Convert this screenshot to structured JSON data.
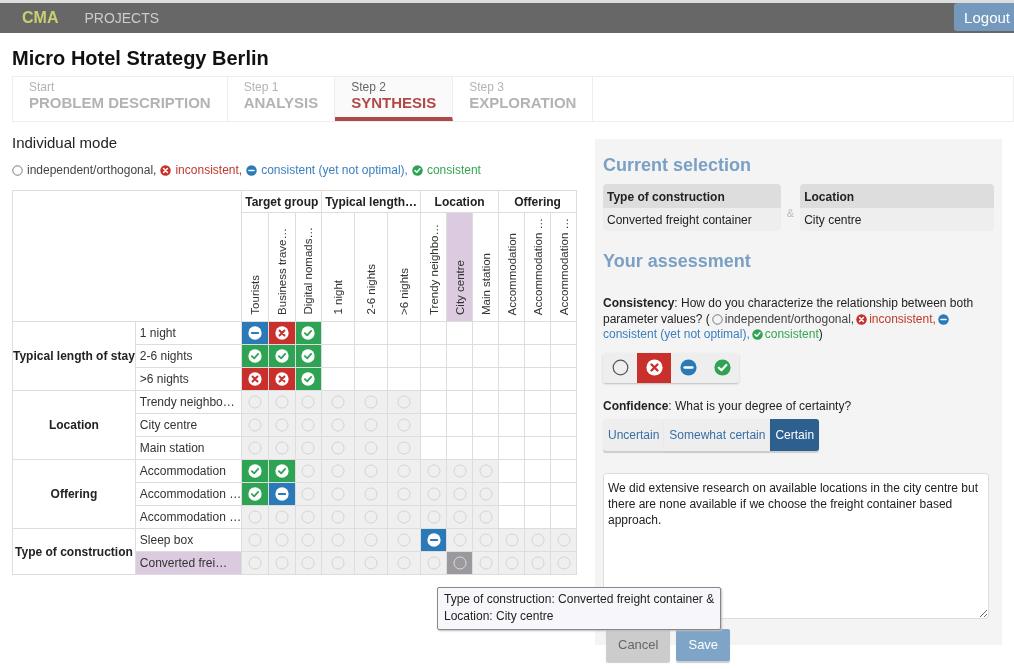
{
  "navbar": {
    "brand": "CMA",
    "menu_item": "PROJECTS",
    "logout": "Logout"
  },
  "project_title": "Micro Hotel Strategy Berlin",
  "steps": [
    {
      "label": "Start",
      "title": "PROBLEM DESCRIPTION",
      "selected": false
    },
    {
      "label": "Step 1",
      "title": "ANALYSIS",
      "selected": false
    },
    {
      "label": "Step 2",
      "title": "SYNTHESIS",
      "selected": true
    },
    {
      "label": "Step 3",
      "title": "EXPLORATION",
      "selected": false
    }
  ],
  "mode": "Individual mode",
  "legend": [
    {
      "kind": "independent",
      "label": "independent/orthogonal,"
    },
    {
      "kind": "inconsistent",
      "label": "inconsistent,"
    },
    {
      "kind": "partial",
      "label": "consistent (yet not optimal),"
    },
    {
      "kind": "consistent",
      "label": "consistent"
    }
  ],
  "matrix": {
    "column_groups": [
      {
        "label": "Target group",
        "columns": [
          {
            "label": "Tourists",
            "highlighted": false
          },
          {
            "label": "Business trave…",
            "highlighted": false
          },
          {
            "label": "Digital nomads…",
            "highlighted": false
          }
        ]
      },
      {
        "label": "Typical length…",
        "columns": [
          {
            "label": "1 night",
            "highlighted": false
          },
          {
            "label": "2-6 nights",
            "highlighted": false
          },
          {
            "label": ">6 nights",
            "highlighted": false
          }
        ]
      },
      {
        "label": "Location",
        "columns": [
          {
            "label": "Trendy neighbo…",
            "highlighted": false
          },
          {
            "label": "City centre",
            "highlighted": true
          },
          {
            "label": "Main station",
            "highlighted": false
          }
        ]
      },
      {
        "label": "Offering",
        "columns": [
          {
            "label": "Accommodation",
            "highlighted": false
          },
          {
            "label": "Accommodation …",
            "highlighted": false
          },
          {
            "label": "Accommodation …",
            "highlighted": false
          }
        ]
      }
    ],
    "row_groups": [
      {
        "label": "Typical length of stay",
        "rows": [
          {
            "label": "1 night",
            "highlighted": false,
            "cells": [
              {
                "kind": "partial",
                "selected": false
              },
              {
                "kind": "inconsistent",
                "selected": false
              },
              {
                "kind": "consistent",
                "selected": false
              },
              {
                "kind": "none",
                "selected": false
              },
              {
                "kind": "none",
                "selected": false
              },
              {
                "kind": "none",
                "selected": false
              },
              {
                "kind": "none",
                "selected": false
              },
              {
                "kind": "none",
                "selected": false
              },
              {
                "kind": "none",
                "selected": false
              },
              {
                "kind": "none",
                "selected": false
              },
              {
                "kind": "none",
                "selected": false
              },
              {
                "kind": "none",
                "selected": false
              }
            ]
          },
          {
            "label": "2-6 nights",
            "highlighted": false,
            "cells": [
              {
                "kind": "consistent",
                "selected": false
              },
              {
                "kind": "consistent",
                "selected": false
              },
              {
                "kind": "consistent",
                "selected": false
              },
              {
                "kind": "none",
                "selected": false
              },
              {
                "kind": "none",
                "selected": false
              },
              {
                "kind": "none",
                "selected": false
              },
              {
                "kind": "none",
                "selected": false
              },
              {
                "kind": "none",
                "selected": false
              },
              {
                "kind": "none",
                "selected": false
              },
              {
                "kind": "none",
                "selected": false
              },
              {
                "kind": "none",
                "selected": false
              },
              {
                "kind": "none",
                "selected": false
              }
            ]
          },
          {
            "label": ">6 nights",
            "highlighted": false,
            "cells": [
              {
                "kind": "inconsistent",
                "selected": false
              },
              {
                "kind": "inconsistent",
                "selected": false
              },
              {
                "kind": "consistent",
                "selected": false
              },
              {
                "kind": "none",
                "selected": false
              },
              {
                "kind": "none",
                "selected": false
              },
              {
                "kind": "none",
                "selected": false
              },
              {
                "kind": "none",
                "selected": false
              },
              {
                "kind": "none",
                "selected": false
              },
              {
                "kind": "none",
                "selected": false
              },
              {
                "kind": "none",
                "selected": false
              },
              {
                "kind": "none",
                "selected": false
              },
              {
                "kind": "none",
                "selected": false
              }
            ]
          }
        ]
      },
      {
        "label": "Location",
        "rows": [
          {
            "label": "Trendy neighbo…",
            "highlighted": false,
            "cells": [
              {
                "kind": "independent",
                "selected": false
              },
              {
                "kind": "independent",
                "selected": false
              },
              {
                "kind": "independent",
                "selected": false
              },
              {
                "kind": "independent",
                "selected": false
              },
              {
                "kind": "independent",
                "selected": false
              },
              {
                "kind": "independent",
                "selected": false
              },
              {
                "kind": "none",
                "selected": false
              },
              {
                "kind": "none",
                "selected": false
              },
              {
                "kind": "none",
                "selected": false
              },
              {
                "kind": "none",
                "selected": false
              },
              {
                "kind": "none",
                "selected": false
              },
              {
                "kind": "none",
                "selected": false
              }
            ]
          },
          {
            "label": "City centre",
            "highlighted": false,
            "cells": [
              {
                "kind": "independent",
                "selected": false
              },
              {
                "kind": "independent",
                "selected": false
              },
              {
                "kind": "independent",
                "selected": false
              },
              {
                "kind": "independent",
                "selected": false
              },
              {
                "kind": "independent",
                "selected": false
              },
              {
                "kind": "independent",
                "selected": false
              },
              {
                "kind": "none",
                "selected": false
              },
              {
                "kind": "none",
                "selected": false
              },
              {
                "kind": "none",
                "selected": false
              },
              {
                "kind": "none",
                "selected": false
              },
              {
                "kind": "none",
                "selected": false
              },
              {
                "kind": "none",
                "selected": false
              }
            ]
          },
          {
            "label": "Main station",
            "highlighted": false,
            "cells": [
              {
                "kind": "independent",
                "selected": false
              },
              {
                "kind": "independent",
                "selected": false
              },
              {
                "kind": "independent",
                "selected": false
              },
              {
                "kind": "independent",
                "selected": false
              },
              {
                "kind": "independent",
                "selected": false
              },
              {
                "kind": "independent",
                "selected": false
              },
              {
                "kind": "none",
                "selected": false
              },
              {
                "kind": "none",
                "selected": false
              },
              {
                "kind": "none",
                "selected": false
              },
              {
                "kind": "none",
                "selected": false
              },
              {
                "kind": "none",
                "selected": false
              },
              {
                "kind": "none",
                "selected": false
              }
            ]
          }
        ]
      },
      {
        "label": "Offering",
        "rows": [
          {
            "label": "Accommodation",
            "highlighted": false,
            "cells": [
              {
                "kind": "consistent",
                "selected": false
              },
              {
                "kind": "consistent",
                "selected": false
              },
              {
                "kind": "independent",
                "selected": false
              },
              {
                "kind": "independent",
                "selected": false
              },
              {
                "kind": "independent",
                "selected": false
              },
              {
                "kind": "independent",
                "selected": false
              },
              {
                "kind": "independent",
                "selected": false
              },
              {
                "kind": "independent",
                "selected": false
              },
              {
                "kind": "independent",
                "selected": false
              },
              {
                "kind": "none",
                "selected": false
              },
              {
                "kind": "none",
                "selected": false
              },
              {
                "kind": "none",
                "selected": false
              }
            ]
          },
          {
            "label": "Accommodation …",
            "highlighted": false,
            "cells": [
              {
                "kind": "consistent",
                "selected": false
              },
              {
                "kind": "partial",
                "selected": false
              },
              {
                "kind": "independent",
                "selected": false
              },
              {
                "kind": "independent",
                "selected": false
              },
              {
                "kind": "independent",
                "selected": false
              },
              {
                "kind": "independent",
                "selected": false
              },
              {
                "kind": "independent",
                "selected": false
              },
              {
                "kind": "independent",
                "selected": false
              },
              {
                "kind": "independent",
                "selected": false
              },
              {
                "kind": "none",
                "selected": false
              },
              {
                "kind": "none",
                "selected": false
              },
              {
                "kind": "none",
                "selected": false
              }
            ]
          },
          {
            "label": "Accommodation …",
            "highlighted": false,
            "cells": [
              {
                "kind": "independent",
                "selected": false
              },
              {
                "kind": "independent",
                "selected": false
              },
              {
                "kind": "independent",
                "selected": false
              },
              {
                "kind": "independent",
                "selected": false
              },
              {
                "kind": "independent",
                "selected": false
              },
              {
                "kind": "independent",
                "selected": false
              },
              {
                "kind": "independent",
                "selected": false
              },
              {
                "kind": "independent",
                "selected": false
              },
              {
                "kind": "independent",
                "selected": false
              },
              {
                "kind": "none",
                "selected": false
              },
              {
                "kind": "none",
                "selected": false
              },
              {
                "kind": "none",
                "selected": false
              }
            ]
          }
        ]
      },
      {
        "label": "Type of construction",
        "rows": [
          {
            "label": "Sleep box",
            "highlighted": false,
            "cells": [
              {
                "kind": "independent",
                "selected": false
              },
              {
                "kind": "independent",
                "selected": false
              },
              {
                "kind": "independent",
                "selected": false
              },
              {
                "kind": "independent",
                "selected": false
              },
              {
                "kind": "independent",
                "selected": false
              },
              {
                "kind": "independent",
                "selected": false
              },
              {
                "kind": "partial",
                "selected": false
              },
              {
                "kind": "independent",
                "selected": false
              },
              {
                "kind": "independent",
                "selected": false
              },
              {
                "kind": "independent",
                "selected": false
              },
              {
                "kind": "independent",
                "selected": false
              },
              {
                "kind": "independent",
                "selected": false
              }
            ]
          },
          {
            "label": "Converted frei…",
            "highlighted": true,
            "cells": [
              {
                "kind": "independent",
                "selected": false
              },
              {
                "kind": "independent",
                "selected": false
              },
              {
                "kind": "independent",
                "selected": false
              },
              {
                "kind": "independent",
                "selected": false
              },
              {
                "kind": "independent",
                "selected": false
              },
              {
                "kind": "independent",
                "selected": false
              },
              {
                "kind": "independent",
                "selected": false
              },
              {
                "kind": "independent",
                "selected": true
              },
              {
                "kind": "independent",
                "selected": false
              },
              {
                "kind": "independent",
                "selected": false
              },
              {
                "kind": "independent",
                "selected": false
              },
              {
                "kind": "independent",
                "selected": false
              }
            ]
          }
        ]
      }
    ]
  },
  "tooltip": "Type of construction: Converted freight container &\nLocation: City centre",
  "panel": {
    "selection_title": "Current selection",
    "selection": [
      {
        "parameter": "Type of construction",
        "value": "Converted freight container"
      },
      {
        "parameter": "Location",
        "value": "City centre"
      }
    ],
    "joiner": "&",
    "assessment_title": "Your assessment",
    "consistency": {
      "question": "**Consistency**: How do you characterize the relationship between both",
      "question_continued": "parameter values? (",
      "options": [
        {
          "kind": "independent",
          "label": "independent/orthogonal,"
        },
        {
          "kind": "inconsistent",
          "label": "inconsistent,"
        },
        {
          "kind": "partial",
          "label": "consistent (yet not optimal),"
        },
        {
          "kind": "consistent",
          "label": "consistent"
        }
      ],
      "closing": ")",
      "choices": [
        {
          "kind": "independent",
          "selected": false
        },
        {
          "kind": "inconsistent",
          "selected": true
        },
        {
          "kind": "partial",
          "selected": false
        },
        {
          "kind": "consistent",
          "selected": false
        }
      ]
    },
    "confidence": {
      "question": "**Confidence**: What is your degree of certainty?",
      "choices": [
        {
          "label": "Uncertain",
          "selected": false
        },
        {
          "label": "Somewhat certain",
          "selected": false
        },
        {
          "label": "Certain",
          "selected": true
        }
      ]
    },
    "comment": "We did extensive research on available locations in the city centre but there are none available if we choose the freight container based approach.",
    "buttons": [
      {
        "label": "Cancel",
        "kind": "cancel"
      },
      {
        "label": "Save",
        "kind": "save"
      }
    ]
  }
}
